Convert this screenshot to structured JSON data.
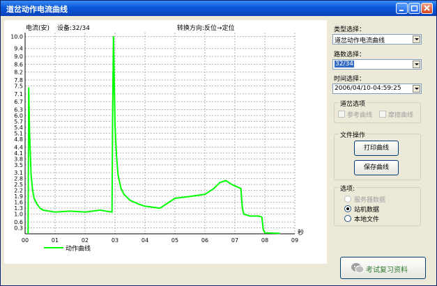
{
  "window": {
    "title": "道岔动作电流曲线"
  },
  "chart": {
    "header_left": "电流(安)",
    "device_label": "设备:32/34",
    "direction_label": "转换方向:反位→定位",
    "x_unit": "秒",
    "legend_label": "动作曲线"
  },
  "panel": {
    "type_label": "类型选择：",
    "type_value": "道岔动作电流曲线",
    "switch_label": "路数选择：",
    "switch_value": "32/34",
    "time_label": "时间选择：",
    "time_value": "2006/04/10-04:59:25",
    "options_group": "道岔选项",
    "ref_curve": "参考曲线",
    "friction_curve": "摩擦曲线",
    "file_group": "文件操作",
    "print_button": "打印曲线",
    "save_button": "保存曲线",
    "choice_group": "选项:",
    "radio_server": "服务器数据",
    "radio_station": "站机数据",
    "radio_local": "本地文件",
    "exit_text": "考试复习资料"
  },
  "colors": {
    "curve": "#00ff00",
    "grid": "#b0b0b0",
    "titlebar": "#0a58d8"
  },
  "chart_data": {
    "type": "line",
    "xlim": [
      0,
      9
    ],
    "ylim": [
      0,
      10.2
    ],
    "x_ticks": [
      "00",
      "01",
      "02",
      "03",
      "04",
      "05",
      "06",
      "07",
      "08",
      "09"
    ],
    "y_ticks": [
      "0.3",
      "0.6",
      "1.0",
      "1.3",
      "1.6",
      "1.9",
      "2.2",
      "2.5",
      "2.8",
      "3.1",
      "3.5",
      "3.8",
      "4.1",
      "4.4",
      "4.8",
      "5.1",
      "5.4",
      "5.7",
      "6.0",
      "6.3",
      "6.7",
      "7.1",
      "7.5",
      "7.8",
      "8.2",
      "8.6",
      "9.0",
      "9.4",
      "10.0"
    ],
    "y_tick_values": [
      0.3,
      0.6,
      1.0,
      1.3,
      1.6,
      1.9,
      2.2,
      2.5,
      2.8,
      3.1,
      3.5,
      3.8,
      4.1,
      4.4,
      4.8,
      5.1,
      5.4,
      5.7,
      6.0,
      6.3,
      6.7,
      7.1,
      7.5,
      7.8,
      8.2,
      8.6,
      9.0,
      9.4,
      10.0
    ],
    "series": [
      {
        "name": "动作曲线",
        "x": [
          0.1,
          0.12,
          0.15,
          0.2,
          0.25,
          0.3,
          0.4,
          0.5,
          0.6,
          0.8,
          1.0,
          1.5,
          2.0,
          2.5,
          2.9,
          2.92,
          2.95,
          3.0,
          3.05,
          3.1,
          3.2,
          3.3,
          3.5,
          3.8,
          4.0,
          4.5,
          5.0,
          5.5,
          6.0,
          6.3,
          6.5,
          6.7,
          6.8,
          6.9,
          7.2,
          7.25,
          7.3,
          7.5,
          7.8,
          7.9,
          7.95,
          8.0,
          8.5
        ],
        "y": [
          0,
          7.4,
          5.0,
          3.0,
          2.2,
          1.8,
          1.5,
          1.3,
          1.2,
          1.15,
          1.1,
          1.15,
          1.1,
          1.2,
          1.1,
          6.0,
          10.0,
          5.5,
          4.0,
          3.0,
          2.3,
          2.0,
          1.7,
          1.5,
          1.4,
          1.3,
          1.8,
          1.9,
          2.0,
          2.3,
          2.6,
          2.7,
          2.6,
          2.5,
          2.3,
          1.3,
          1.0,
          0.9,
          0.9,
          0.85,
          0.2,
          0.05,
          0.02
        ]
      }
    ]
  }
}
